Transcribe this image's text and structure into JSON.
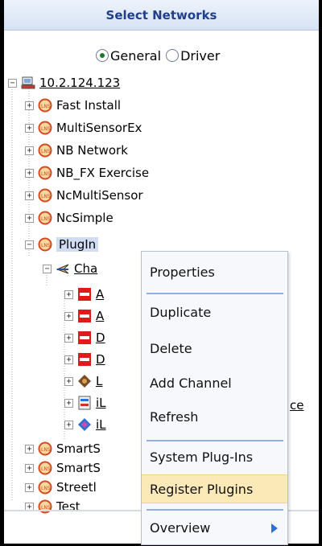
{
  "header": {
    "title": "Select Networks"
  },
  "view_options": [
    {
      "label": "General",
      "checked": true
    },
    {
      "label": "Driver",
      "checked": false
    }
  ],
  "tree": {
    "root": {
      "label": "10.2.124.123",
      "expander": "⊟"
    },
    "networks": [
      {
        "label": "Fast Install",
        "expander": "+"
      },
      {
        "label": "MultiSensorEx",
        "expander": "+"
      },
      {
        "label": "NB Network",
        "expander": "+"
      },
      {
        "label": "NB_FX Exercise",
        "expander": "+"
      },
      {
        "label": "NcMultiSensor",
        "expander": "+"
      },
      {
        "label": "NcSimple",
        "expander": "+"
      }
    ],
    "selected": {
      "label": "PlugIn",
      "expander": "−"
    },
    "channel": {
      "label": "Cha",
      "expander": "−"
    },
    "devices": [
      {
        "label": "A",
        "icon": "red-device-icon",
        "expander": "+"
      },
      {
        "label": "A",
        "icon": "red-device-icon",
        "expander": "+"
      },
      {
        "label": "D",
        "icon": "red-device-icon",
        "expander": "+"
      },
      {
        "label": "D",
        "icon": "red-device-icon",
        "expander": "+"
      },
      {
        "label": "L",
        "icon": "device-gear-icon",
        "expander": "+"
      },
      {
        "label": "iL",
        "icon": "device-panel-icon",
        "expander": "+"
      },
      {
        "label": "iL",
        "icon": "device-blue-icon",
        "expander": "+"
      }
    ],
    "device_tail_text": "ce",
    "bottom_networks": [
      {
        "label": "SmartS",
        "expander": "+"
      },
      {
        "label": "SmartS",
        "expander": "+"
      },
      {
        "label": "Streetl",
        "expander": "+"
      },
      {
        "label": "Test",
        "expander": "+"
      }
    ]
  },
  "context_menu": {
    "items": [
      {
        "label": "Properties"
      },
      {
        "label": "Duplicate"
      },
      {
        "label": "Delete"
      },
      {
        "label": "Add Channel"
      },
      {
        "label": "Refresh"
      },
      {
        "label": "System Plug-Ins"
      },
      {
        "label": "Register Plugins",
        "highlighted": true
      },
      {
        "label": "Overview",
        "has_submenu": true
      }
    ]
  },
  "colors": {
    "header_text": "#1f3f8a",
    "menu_separator": "#8fb0e6",
    "menu_hover": "#fbe9b7",
    "submenu_arrow": "#2f6fd8"
  }
}
